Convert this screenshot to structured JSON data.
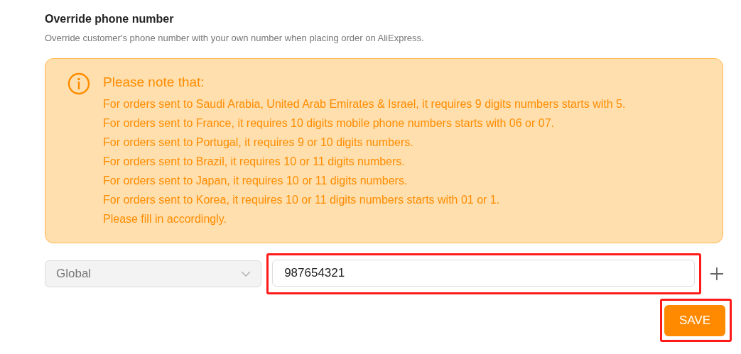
{
  "title": "Override phone number",
  "description": "Override customer's phone number with your own number when placing order on AliExpress.",
  "notice": {
    "heading": "Please note that:",
    "lines": [
      "For orders sent to Saudi Arabia, United Arab Emirates & Israel, it requires 9 digits numbers starts with 5.",
      "For orders sent to France, it requires 10 digits mobile phone numbers starts with 06 or 07.",
      "For orders sent to Portugal, it requires 9 or 10 digits numbers.",
      "For orders sent to Brazil, it requires 10 or 11 digits numbers.",
      "For orders sent to Japan, it requires 10 or 11 digits numbers.",
      "For orders sent to Korea, it requires 10 or 11 digits numbers starts with 01 or 1.",
      "Please fill in accordingly."
    ]
  },
  "region_select": {
    "value": "Global",
    "disabled": true
  },
  "phone_field": {
    "value": "987654321",
    "highlighted": true
  },
  "save_button": {
    "label": "SAVE",
    "highlighted": true
  }
}
